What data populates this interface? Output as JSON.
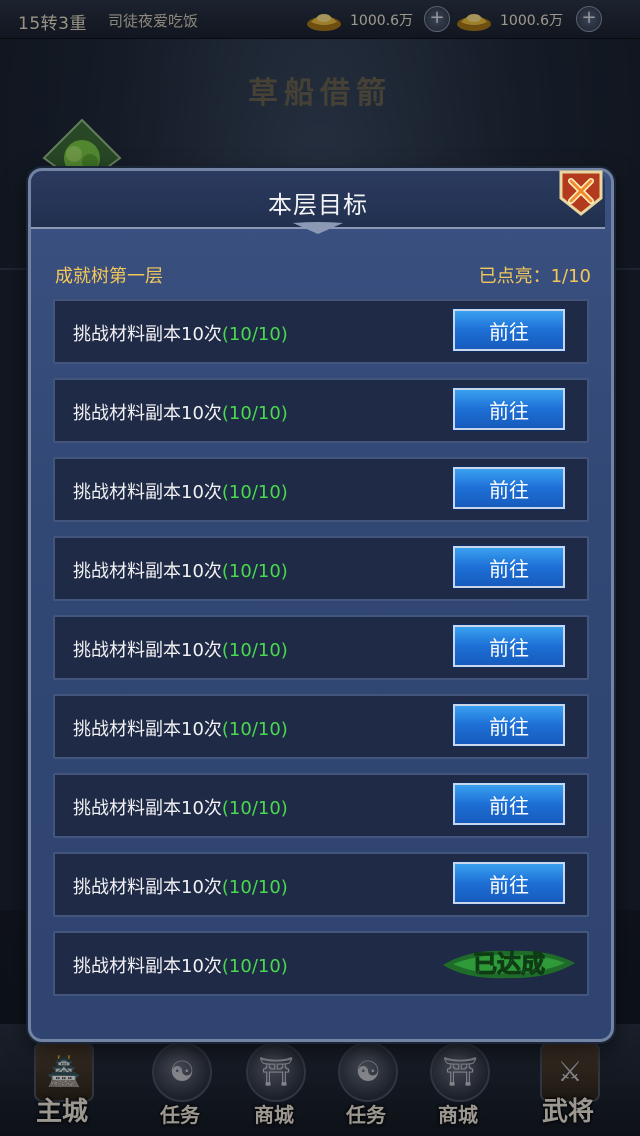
{
  "topbar": {
    "level": "15转3重",
    "player_name": "司徒夜爱吃饭",
    "resources": [
      {
        "icon": "gold-ingot-icon",
        "value": "1000.6万"
      },
      {
        "icon": "silver-ingot-icon",
        "value": "1000.6万"
      }
    ]
  },
  "scene": {
    "title": "草船借箭"
  },
  "modal": {
    "title": "本层目标",
    "layer_name": "成就树第一层",
    "lit_label": "已点亮：1/10",
    "go_label": "前往",
    "done_label": "已达成",
    "tasks": [
      {
        "text": "挑战材料副本10次",
        "progress": "(10/10)",
        "status": "go"
      },
      {
        "text": "挑战材料副本10次",
        "progress": "(10/10)",
        "status": "go"
      },
      {
        "text": "挑战材料副本10次",
        "progress": "(10/10)",
        "status": "go"
      },
      {
        "text": "挑战材料副本10次",
        "progress": "(10/10)",
        "status": "go"
      },
      {
        "text": "挑战材料副本10次",
        "progress": "(10/10)",
        "status": "go"
      },
      {
        "text": "挑战材料副本10次",
        "progress": "(10/10)",
        "status": "go"
      },
      {
        "text": "挑战材料副本10次",
        "progress": "(10/10)",
        "status": "go"
      },
      {
        "text": "挑战材料副本10次",
        "progress": "(10/10)",
        "status": "go"
      },
      {
        "text": "挑战材料副本10次",
        "progress": "(10/10)",
        "status": "done"
      }
    ]
  },
  "bottom_nav": [
    {
      "label": "主城",
      "icon": "city-icon"
    },
    {
      "label": "任务",
      "icon": "task-icon"
    },
    {
      "label": "商城",
      "icon": "shop-icon"
    },
    {
      "label": "任务",
      "icon": "task-icon"
    },
    {
      "label": "商城",
      "icon": "shop-icon"
    },
    {
      "label": "武将",
      "icon": "general-icon"
    }
  ],
  "colors": {
    "accent_gold": "#f4c75a",
    "progress_green": "#49d94f",
    "button_blue": "#1d6fd6"
  }
}
